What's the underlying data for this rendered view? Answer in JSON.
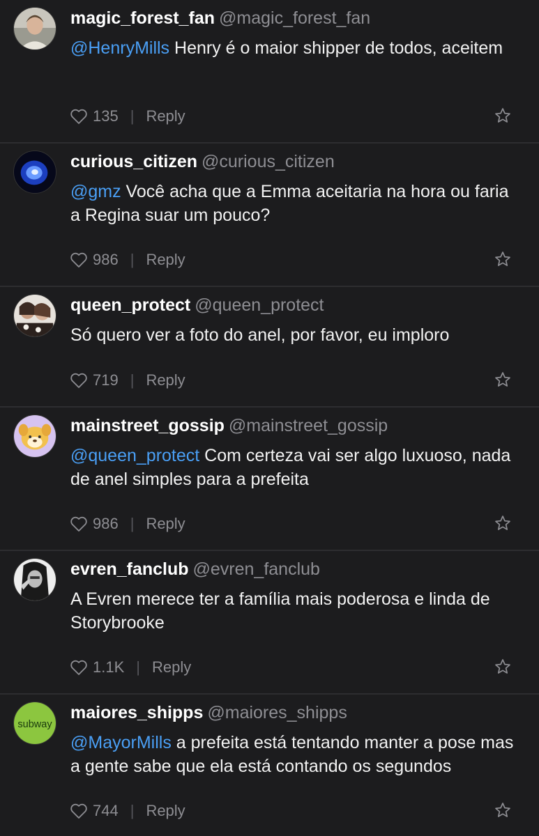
{
  "comments": [
    {
      "username": "magic_forest_fan",
      "handle": "@magic_forest_fan",
      "mention": "@HenryMills",
      "text": " Henry é o maior shipper de todos, aceitem",
      "likes": "135",
      "reply": "Reply",
      "avatar_icon": "avatar-photo-man"
    },
    {
      "username": "curious_citizen",
      "handle": "@curious_citizen",
      "mention": "@gmz",
      "text": " Você acha que a Emma aceitaria na hora ou faria a Regina suar um pouco?",
      "likes": "986",
      "reply": "Reply",
      "avatar_icon": "avatar-blue-glow"
    },
    {
      "username": "queen_protect",
      "handle": "@queen_protect",
      "mention": "",
      "text": "Só quero ver a foto do anel, por favor, eu imploro",
      "likes": "719",
      "reply": "Reply",
      "avatar_icon": "avatar-photo-women"
    },
    {
      "username": "mainstreet_gossip",
      "handle": "@mainstreet_gossip",
      "mention": "@queen_protect",
      "text": " Com certeza vai ser algo luxuoso, nada de anel simples para a prefeita",
      "likes": "986",
      "reply": "Reply",
      "avatar_icon": "avatar-cartoon-dog"
    },
    {
      "username": "evren_fanclub",
      "handle": "@evren_fanclub",
      "mention": "",
      "text": "A Evren merece ter a família mais poderosa e linda de Storybrooke",
      "likes": "1.1K",
      "reply": "Reply",
      "avatar_icon": "avatar-photo-woman-bw"
    },
    {
      "username": "maiores_shipps",
      "handle": "@maiores_shipps",
      "mention": "@MayorMills",
      "text": " a prefeita está tentando manter a pose mas a gente sabe que ela está contando os segundos",
      "likes": "744",
      "reply": "Reply",
      "avatar_icon": "avatar-subway-logo",
      "avatar_logo_text": "subway"
    }
  ],
  "colors": {
    "background": "#1c1c1e",
    "mention": "#4a9ff5",
    "secondary": "#8e8e93",
    "divider": "#2d2d30"
  }
}
